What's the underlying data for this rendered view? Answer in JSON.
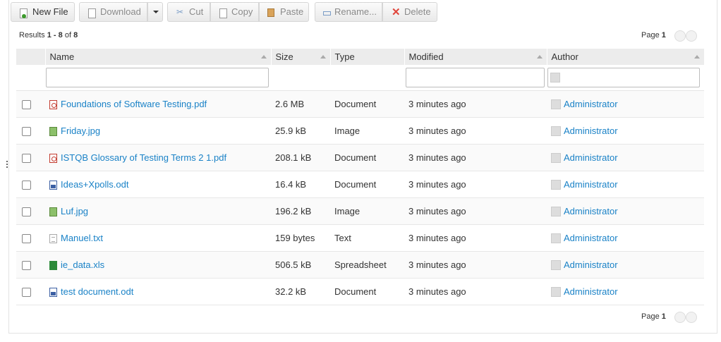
{
  "toolbar": {
    "new_file": "New File",
    "download": "Download",
    "cut": "Cut",
    "copy": "Copy",
    "paste": "Paste",
    "rename": "Rename...",
    "delete": "Delete"
  },
  "results": {
    "prefix": "Results ",
    "range": "1 - 8",
    "of": " of ",
    "total": "8"
  },
  "pager": {
    "label": "Page ",
    "page": "1"
  },
  "columns": {
    "name": "Name",
    "size": "Size",
    "type": "Type",
    "modified": "Modified",
    "author": "Author"
  },
  "rows": [
    {
      "icon": "pdf-icon",
      "name": "Foundations of Software Testing.pdf",
      "size": "2.6 MB",
      "type": "Document",
      "modified": "3 minutes ago",
      "author": "Administrator"
    },
    {
      "icon": "image-icon",
      "name": "Friday.jpg",
      "size": "25.9 kB",
      "type": "Image",
      "modified": "3 minutes ago",
      "author": "Administrator"
    },
    {
      "icon": "pdf-icon",
      "name": "ISTQB Glossary of Testing Terms 2 1.pdf",
      "size": "208.1 kB",
      "type": "Document",
      "modified": "3 minutes ago",
      "author": "Administrator"
    },
    {
      "icon": "word-doc-icon",
      "name": "Ideas+Xpolls.odt",
      "size": "16.4 kB",
      "type": "Document",
      "modified": "3 minutes ago",
      "author": "Administrator"
    },
    {
      "icon": "image-icon",
      "name": "Luf.jpg",
      "size": "196.2 kB",
      "type": "Image",
      "modified": "3 minutes ago",
      "author": "Administrator"
    },
    {
      "icon": "text-file-icon",
      "name": "Manuel.txt",
      "size": "159 bytes",
      "type": "Text",
      "modified": "3 minutes ago",
      "author": "Administrator"
    },
    {
      "icon": "spreadsheet-icon",
      "name": "ie_data.xls",
      "size": "506.5 kB",
      "type": "Spreadsheet",
      "modified": "3 minutes ago",
      "author": "Administrator"
    },
    {
      "icon": "word-doc-icon",
      "name": "test document.odt",
      "size": "32.2 kB",
      "type": "Document",
      "modified": "3 minutes ago",
      "author": "Administrator"
    }
  ],
  "colors": {
    "link": "#1a82c7",
    "header_bg": "#ececec"
  }
}
